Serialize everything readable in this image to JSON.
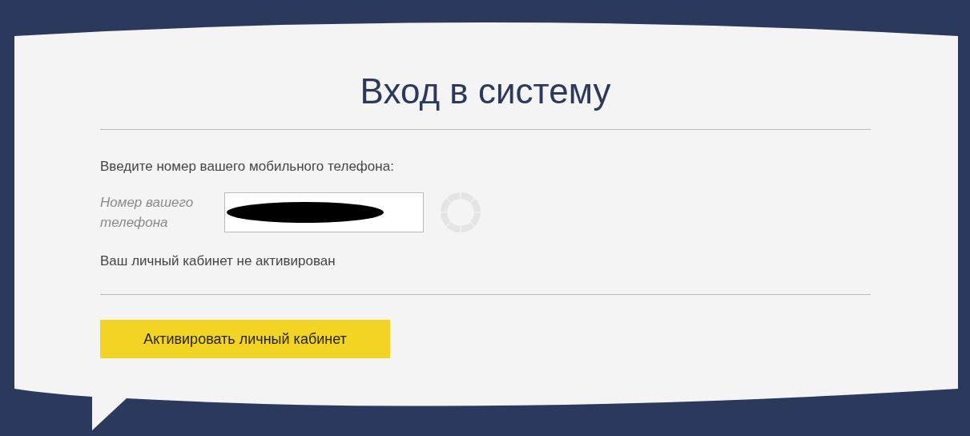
{
  "title": "Вход в систему",
  "prompt": "Введите номер вашего мобильного телефона:",
  "phone_field": {
    "label": "Номер вашего телефона",
    "redacted": true,
    "loading": true
  },
  "status": "Ваш личный кабинет не активирован",
  "button": "Активировать личный кабинет"
}
